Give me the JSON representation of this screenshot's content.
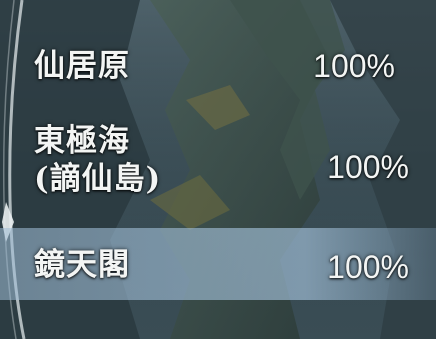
{
  "region_list": {
    "items": [
      {
        "name": "仙居原",
        "progress": "100%",
        "selected": false
      },
      {
        "name": "東極海\n(謫仙島)",
        "progress": "100%",
        "selected": false
      },
      {
        "name": "鏡天閣",
        "progress": "100%",
        "selected": true
      }
    ]
  },
  "colors": {
    "text": "#f3f5f4",
    "selected_highlight": "#a6c3dc",
    "panel_background": "#2c3b43"
  },
  "icons": {
    "left_frame": "ornate-frame-arc"
  }
}
